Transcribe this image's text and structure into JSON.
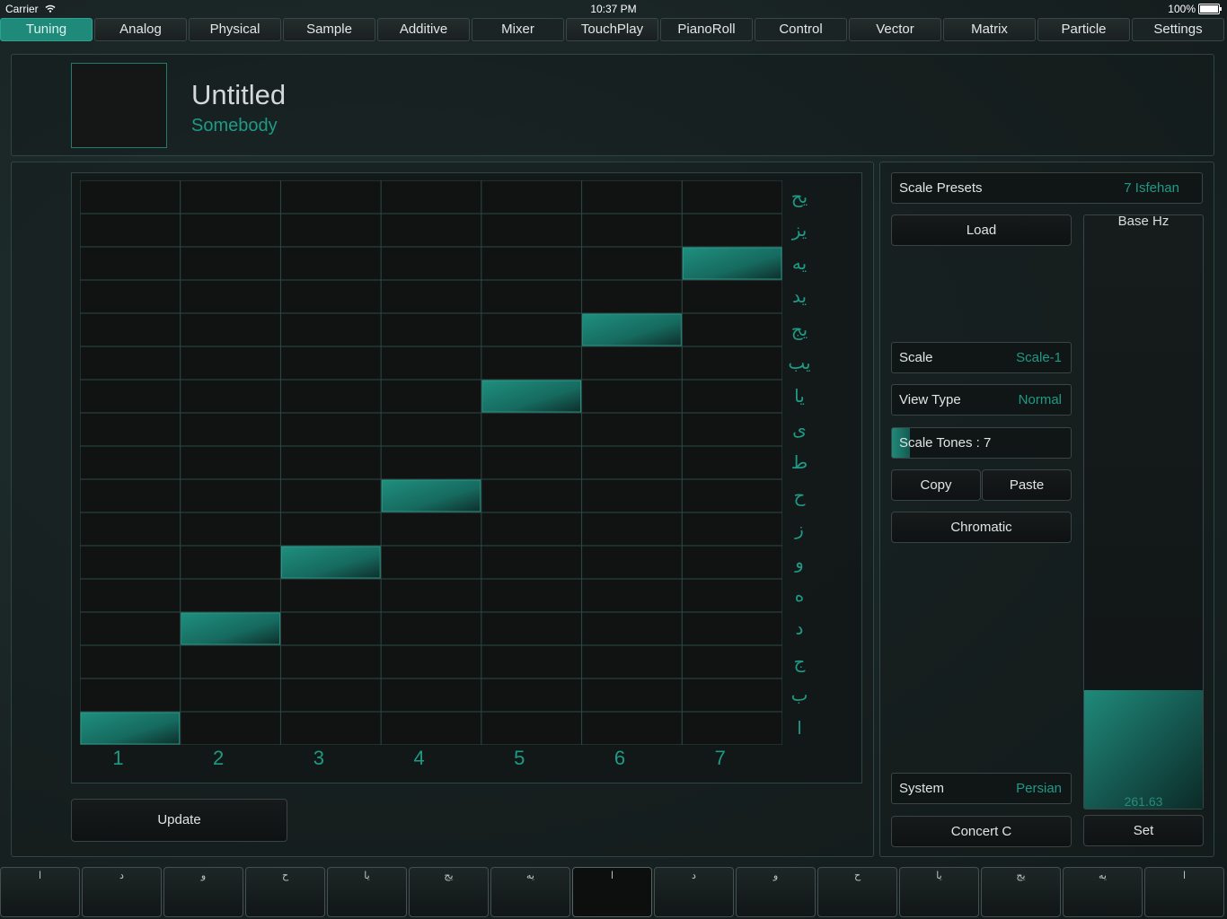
{
  "status": {
    "carrier": "Carrier",
    "time": "10:37 PM",
    "battery": "100%"
  },
  "tabs": [
    {
      "label": "Tuning",
      "active": true
    },
    {
      "label": "Analog"
    },
    {
      "label": "Physical"
    },
    {
      "label": "Sample"
    },
    {
      "label": "Additive"
    },
    {
      "label": "Mixer",
      "dark": true
    },
    {
      "label": "TouchPlay"
    },
    {
      "label": "PianoRoll",
      "dark": true
    },
    {
      "label": "Control",
      "dark": true
    },
    {
      "label": "Vector"
    },
    {
      "label": "Matrix"
    },
    {
      "label": "Particle"
    },
    {
      "label": "Settings",
      "dark": true
    }
  ],
  "header": {
    "title": "Untitled",
    "author": "Somebody"
  },
  "grid": {
    "row_labels": [
      "يح",
      "يز",
      "يه",
      "يد",
      "يج",
      "يب",
      "يا",
      "ى",
      "ط",
      "ح",
      "ز",
      "و",
      "ه",
      "د",
      "ج",
      "ب",
      "ا"
    ],
    "col_labels": [
      "1",
      "2",
      "3",
      "4",
      "5",
      "6",
      "7"
    ],
    "notes": [
      {
        "col": 1,
        "row": "ا"
      },
      {
        "col": 2,
        "row": "د"
      },
      {
        "col": 3,
        "row": "و"
      },
      {
        "col": 4,
        "row": "ح"
      },
      {
        "col": 5,
        "row": "يا"
      },
      {
        "col": 6,
        "row": "يج"
      },
      {
        "col": 7,
        "row": "يه"
      }
    ]
  },
  "update_label": "Update",
  "side": {
    "scale_presets": {
      "label": "Scale Presets",
      "value": "7 Isfehan"
    },
    "load_label": "Load",
    "scale": {
      "label": "Scale",
      "value": "Scale-1"
    },
    "view_type": {
      "label": "View Type",
      "value": "Normal"
    },
    "scale_tones": {
      "label": "Scale Tones : 7",
      "fill": 0.1
    },
    "copy_label": "Copy",
    "paste_label": "Paste",
    "chromatic_label": "Chromatic",
    "system": {
      "label": "System",
      "value": "Persian"
    },
    "concert_label": "Concert C",
    "base_hz": {
      "label": "Base Hz",
      "value": "261.63",
      "fill": 0.2
    },
    "set_label": "Set"
  },
  "keys": [
    {
      "label": "ا"
    },
    {
      "label": "د"
    },
    {
      "label": "و"
    },
    {
      "label": "ح"
    },
    {
      "label": "يا"
    },
    {
      "label": "يج"
    },
    {
      "label": "يه"
    },
    {
      "label": "ا",
      "dark": true
    },
    {
      "label": "د"
    },
    {
      "label": "و"
    },
    {
      "label": "ح"
    },
    {
      "label": "يا"
    },
    {
      "label": "يج"
    },
    {
      "label": "يه"
    },
    {
      "label": "ا"
    }
  ],
  "colors": {
    "accent": "#1f8a7a",
    "accent_text": "#1f9a86",
    "panel_border": "#2e4545"
  },
  "icons": {
    "wifi": "wifi-icon",
    "battery": "battery-icon"
  }
}
